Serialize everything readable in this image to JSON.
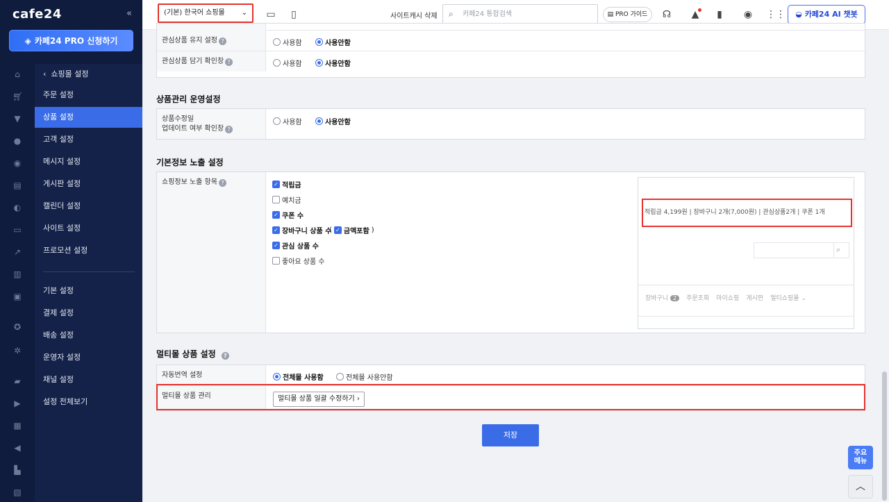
{
  "sidebar": {
    "logo": "cafe24",
    "collapse_icon": "«",
    "pro_button": "카페24 PRO 신청하기",
    "back_label": "쇼핑몰 설정",
    "items": [
      {
        "label": "주문 설정"
      },
      {
        "label": "상품 설정",
        "active": true
      },
      {
        "label": "고객 설정"
      },
      {
        "label": "메시지 설정"
      },
      {
        "label": "게시판 설정"
      },
      {
        "label": "캘린더 설정"
      },
      {
        "label": "사이트 설정"
      },
      {
        "label": "프로모션 설정"
      }
    ],
    "items2": [
      {
        "label": "기본 설정"
      },
      {
        "label": "결제 설정"
      },
      {
        "label": "배송 설정"
      },
      {
        "label": "운영자 설정"
      },
      {
        "label": "채널 설정"
      },
      {
        "label": "설정 전체보기"
      }
    ]
  },
  "topbar": {
    "shop_select": "(기본) 한국어 쇼핑몰",
    "cache_delete": "사이트캐시 삭제",
    "search_placeholder": "카페24 통합검색",
    "pro_guide": "PRO 가이드",
    "ai_chatbot": "카페24 AI 챗봇"
  },
  "sections": {
    "wishlist": {
      "keep_label": "관심상품 유지 설정",
      "confirm_label": "관심상품 담기 확인창",
      "use": "사용함",
      "not_use": "사용안함"
    },
    "product_ops": {
      "title": "상품관리 운영설정",
      "row_label_1": "상품수정일",
      "row_label_2": "업데이트 여부 확인창",
      "use": "사용함",
      "not_use": "사용안함"
    },
    "basic_info": {
      "title": "기본정보 노출 설정",
      "row_label": "쇼핑정보 노출 항목",
      "options": [
        {
          "label": "적립금",
          "checked": true
        },
        {
          "label": "예치금",
          "checked": false
        },
        {
          "label": "쿠폰 수",
          "checked": true
        },
        {
          "label": "장바구니 상품 수",
          "checked": true
        },
        {
          "label": "관심 상품 수",
          "checked": true
        },
        {
          "label": "좋아요 상품 수",
          "checked": false
        }
      ],
      "amount_include": "금액포함",
      "paren_open": "(",
      "paren_close": ")",
      "preview": {
        "summary": "적립금 4,199원 | 장바구니 2개(7,000원) | 관심상품2개 | 쿠폰 1개",
        "nav": [
          "장바구니",
          "주문조회",
          "마이쇼핑",
          "게시판",
          "멀티쇼핑몰"
        ],
        "cart_badge": "2"
      }
    },
    "multimall": {
      "title": "멀티몰 상품 설정",
      "auto_translate_label": "자동번역 설정",
      "all_use": "전체몰 사용함",
      "all_not_use": "전체몰 사용안함",
      "manage_label": "멀티몰 상품 관리",
      "manage_button": "멀티몰 상품 일괄 수정하기"
    }
  },
  "save_button": "저장",
  "floating": {
    "main_menu_1": "주요",
    "main_menu_2": "메뉴",
    "top_icon": "︿"
  },
  "colors": {
    "accent": "#3a6ce8",
    "highlight": "#e5322d",
    "sidebar_bg": "#0f1c3d"
  }
}
